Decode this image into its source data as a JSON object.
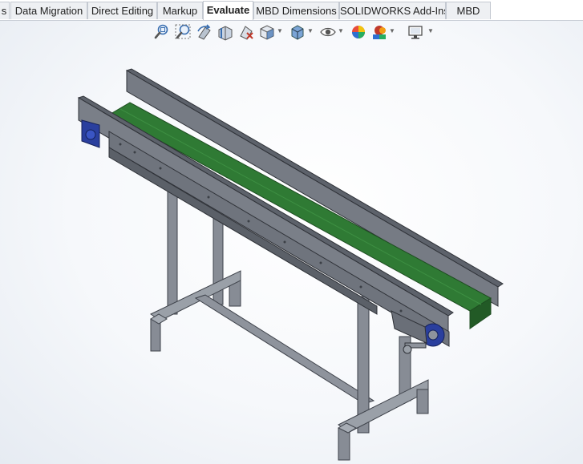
{
  "tabs": [
    {
      "label": "s",
      "active": false
    },
    {
      "label": "Data Migration",
      "active": false
    },
    {
      "label": "Direct Editing",
      "active": false
    },
    {
      "label": "Markup",
      "active": false
    },
    {
      "label": "Evaluate",
      "active": true
    },
    {
      "label": "MBD Dimensions",
      "active": false
    },
    {
      "label": "SOLIDWORKS Add-Ins",
      "active": false
    },
    {
      "label": "MBD",
      "active": false
    }
  ],
  "heads_up_toolbar": [
    {
      "icon": "zoom-to-fit-icon"
    },
    {
      "icon": "zoom-to-area-icon"
    },
    {
      "icon": "previous-view-icon"
    },
    {
      "icon": "section-view-icon"
    },
    {
      "icon": "dynamic-annotation-views-icon"
    },
    {
      "icon": "view-orientation-icon",
      "dropdown": true
    },
    {
      "icon": "display-style-icon",
      "dropdown": true
    },
    {
      "icon": "hide-show-items-icon",
      "dropdown": true
    },
    {
      "icon": "edit-appearance-icon"
    },
    {
      "icon": "apply-scene-icon",
      "dropdown": true
    },
    {
      "icon": "view-settings-icon",
      "dropdown": true
    }
  ],
  "colors": {
    "belt": "#2f7a34",
    "frame": "#7a7f88",
    "frame_dark": "#4c5058",
    "motor": "#2a3f9e",
    "accent": "#1f5fb4"
  },
  "model": {
    "name": "belt-conveyor-assembly"
  }
}
